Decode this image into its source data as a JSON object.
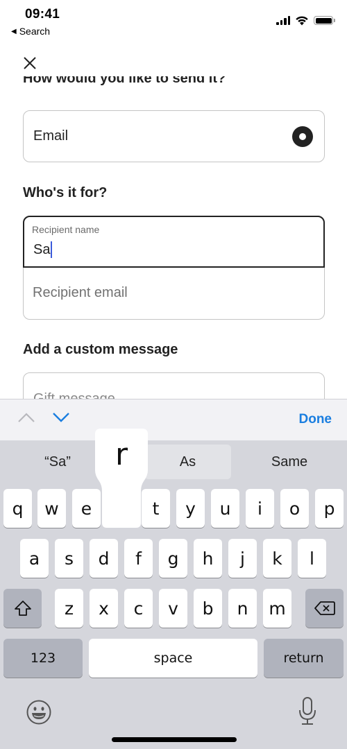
{
  "status_bar": {
    "time": "09:41",
    "back_label": "Search",
    "back_icon": "back-triangle-icon",
    "icons": [
      "cellular-signal-icon",
      "wifi-icon",
      "battery-icon"
    ]
  },
  "header": {
    "close_icon": "close-icon"
  },
  "form": {
    "delivery_heading": "How would you like to send it?",
    "delivery_option": {
      "label": "Email",
      "selected": true
    },
    "recipient_heading": "Who's it for?",
    "recipient_name": {
      "label": "Recipient name",
      "value": "Sa"
    },
    "recipient_email": {
      "placeholder": "Recipient email",
      "value": ""
    },
    "message_heading": "Add a custom message",
    "gift_message": {
      "placeholder": "Gift message",
      "value": ""
    }
  },
  "accessory_bar": {
    "prev_icon": "chevron-up-icon",
    "next_icon": "chevron-down-icon",
    "done_label": "Done",
    "accent_color": "#1a7ee0"
  },
  "keyboard": {
    "suggestions": [
      "“Sa”",
      "As",
      "Same"
    ],
    "pressed_key": "r",
    "row1": [
      "q",
      "w",
      "e",
      "r",
      "t",
      "y",
      "u",
      "i",
      "o",
      "p"
    ],
    "row2": [
      "a",
      "s",
      "d",
      "f",
      "g",
      "h",
      "j",
      "k",
      "l"
    ],
    "row3": [
      "z",
      "x",
      "c",
      "v",
      "b",
      "n",
      "m"
    ],
    "shift_icon": "shift-icon",
    "delete_icon": "delete-backspace-icon",
    "numbers_label": "123",
    "space_label": "space",
    "return_label": "return",
    "emoji_icon": "emoji-icon",
    "mic_icon": "microphone-icon"
  }
}
